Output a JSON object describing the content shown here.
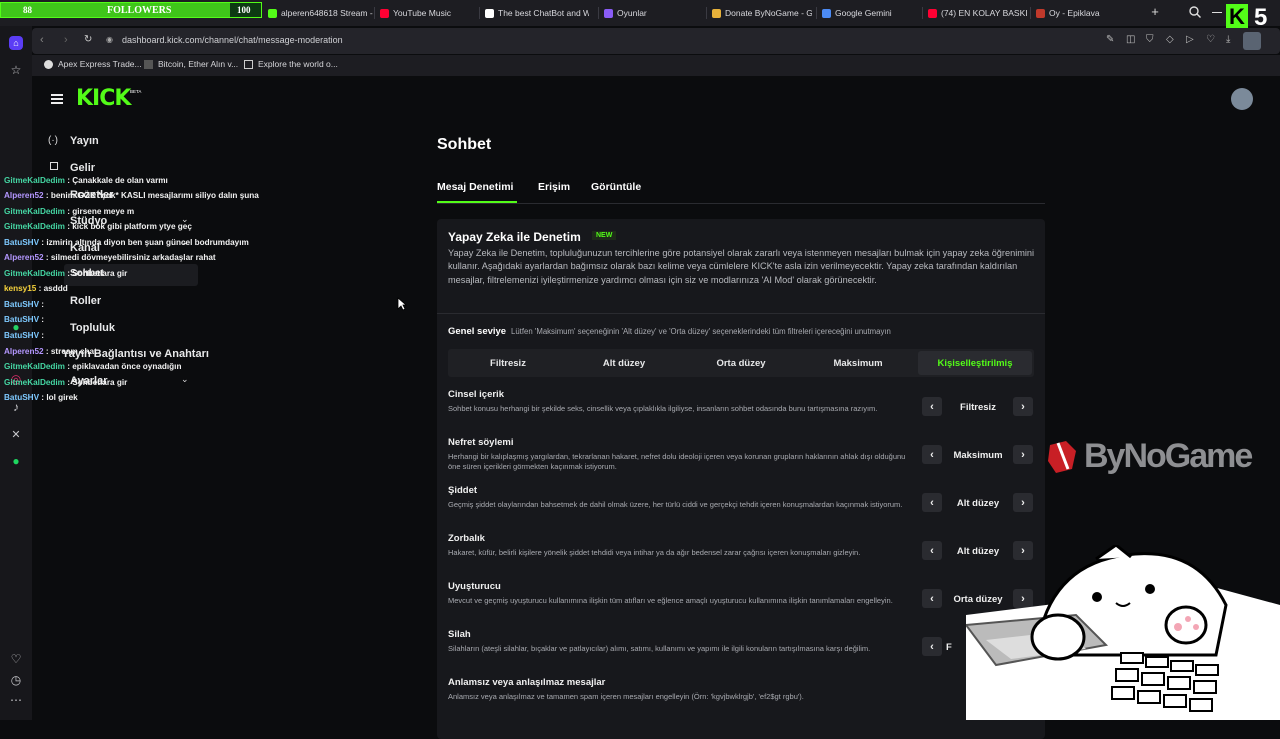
{
  "overlay": {
    "followers_label": "FOLLOWERS",
    "followers_current": "88",
    "followers_goal": "100",
    "followers_progress": 0.88,
    "badge_number": "5",
    "sponsor": "ByNoGame"
  },
  "browser": {
    "tabs": [
      {
        "label": "alperen648618 Stream -",
        "color": "#53fc18"
      },
      {
        "label": "YouTube Music",
        "color": "#ff0033"
      },
      {
        "label": "The best ChatBot and W",
        "color": "#ffffff"
      },
      {
        "label": "Oyunlar",
        "color": "#8a5cf6"
      },
      {
        "label": "Donate ByNoGame - Ge",
        "color": "#e7b13a"
      },
      {
        "label": "Google Gemini",
        "color": "#4c8bf5"
      },
      {
        "label": "(74) EN KOLAY BASKIN I",
        "color": "#ff0033"
      },
      {
        "label": "Oy - Epiklava",
        "color": "#c0392b"
      }
    ],
    "url": "dashboard.kick.com/channel/chat/message-moderation",
    "bookmarks": [
      "Apex Express Trade...",
      "Bitcoin, Ether Alın v...",
      "Explore the world o..."
    ]
  },
  "header": {
    "logo": "KICK",
    "logo_tag": "BETA"
  },
  "nav": {
    "items": [
      "Yayın",
      "Gelir",
      "Rozetler",
      "Stüdyo",
      "Kanal",
      "Sohbet",
      "Roller",
      "Topluluk",
      "Yayın Bağlantısı ve Anahtarı",
      "Ayarlar"
    ]
  },
  "chat": [
    {
      "user": "GitmeKalDedim",
      "color": "#45d6a3",
      "msg": "Çanakkale de olan varmı"
    },
    {
      "user": "Alperen52",
      "color": "#b497ff",
      "msg": "benim GÖK *çok* KASLI mesajlarımı siliyo dalın şuna"
    },
    {
      "user": "GitmeKalDedim",
      "color": "#45d6a3",
      "msg": "girsene meye m"
    },
    {
      "user": "GitmeKalDedim",
      "color": "#45d6a3",
      "msg": "kick bok gibi platform ytye geç"
    },
    {
      "user": "BatuSHV",
      "color": "#7ec9ff",
      "msg": "izmirin altında diyon ben şuan güncel bodrumdayım"
    },
    {
      "user": "Alperen52",
      "color": "#b497ff",
      "msg": "silmedi dövmeyebilirsiniz arkadaşlar rahat"
    },
    {
      "user": "GitmeKalDedim",
      "color": "#45d6a3",
      "msg": "Sohbetlara gir"
    },
    {
      "user": "kensy15",
      "color": "#f7d33c",
      "msg": "asddd"
    },
    {
      "user": "BatuSHV",
      "color": "#7ec9ff",
      "msg": ""
    },
    {
      "user": "BatuSHV",
      "color": "#7ec9ff",
      "msg": ""
    },
    {
      "user": "BatuSHV",
      "color": "#7ec9ff",
      "msg": ""
    },
    {
      "user": "Alperen52",
      "color": "#b497ff",
      "msg": "stream chat"
    },
    {
      "user": "GitmeKalDedim",
      "color": "#45d6a3",
      "msg": "epiklavadan önce oynadığın"
    },
    {
      "user": "GitmeKalDedim",
      "color": "#45d6a3",
      "msg": "Sohbetlara gir"
    },
    {
      "user": "BatuSHV",
      "color": "#7ec9ff",
      "msg": "lol girek"
    }
  ],
  "main": {
    "title": "Sohbet",
    "tabs": [
      "Mesaj Denetimi",
      "Erişim",
      "Görüntüle"
    ],
    "ai_title": "Yapay Zeka ile Denetim",
    "ai_badge": "NEW",
    "ai_desc": "Yapay Zeka ile Denetim, topluluğunuzun tercihlerine göre potansiyel olarak zararlı veya istenmeyen mesajları bulmak için yapay zeka öğrenimini kullanır. Aşağıdaki ayarlardan bağımsız olarak bazı kelime veya cümlelere KICK'te asla izin verilmeyecektir. Yapay zeka tarafından kaldırılan mesajlar, filtrelemenizi iyileştirmenize yardımcı olması için siz ve modlarınıza 'AI Mod' olarak görünecektir.",
    "general_label": "Genel seviye",
    "general_hint": "Lütfen 'Maksimum' seçeneğinin 'Alt düzey' ve 'Orta düzey' seçeneklerindeki tüm filtreleri içereceğini unutmayın",
    "levels": [
      "Filtresiz",
      "Alt düzey",
      "Orta düzey",
      "Maksimum",
      "Kişiselleştirilmiş"
    ],
    "active_level": 4,
    "rules": [
      {
        "title": "Cinsel içerik",
        "desc": "Sohbet konusu herhangi bir şekilde seks, cinsellik veya çıplaklıkla ilgiliyse, insanların sohbet odasında bunu tartışmasına razıyım.",
        "value": "Filtresiz"
      },
      {
        "title": "Nefret söylemi",
        "desc": "Herhangi bir kalıplaşmış yargılardan, tekrarlanan hakaret, nefret dolu ideoloji içeren veya korunan grupların haklarının ahlak dışı olduğunu öne süren içerikleri görmekten kaçınmak istiyorum.",
        "value": "Maksimum"
      },
      {
        "title": "Şiddet",
        "desc": "Geçmiş şiddet olaylarından bahsetmek de dahil olmak üzere, her türlü ciddi ve gerçekçi tehdit içeren konuşmalardan kaçınmak istiyorum.",
        "value": "Alt düzey"
      },
      {
        "title": "Zorbalık",
        "desc": "Hakaret, küfür, belirli kişilere yönelik şiddet tehdidi veya intihar ya da ağır bedensel zarar çağrısı içeren konuşmaları gizleyin.",
        "value": "Alt düzey"
      },
      {
        "title": "Uyuşturucu",
        "desc": "Mevcut ve geçmiş uyuşturucu kullanımına ilişkin tüm atıfları ve eğlence amaçlı uyuşturucu kullanımına ilişkin tanımlamaları engelleyin.",
        "value": "Orta düzey"
      },
      {
        "title": "Silah",
        "desc": "Silahların (ateşli silahlar, bıçaklar ve patlayıcılar) alımı, satımı, kullanımı ve yapımı ile ilgili konuların tartışılmasına karşı değilim.",
        "value": "F"
      },
      {
        "title": "Anlamsız veya anlaşılmaz mesajlar",
        "desc": "Anlamsız veya anlaşılmaz ve tamamen spam içeren mesajları engelleyin (Örn: 'kgvjbwklrgjb', 'ef2$gt rgbu').",
        "value": ""
      }
    ]
  }
}
